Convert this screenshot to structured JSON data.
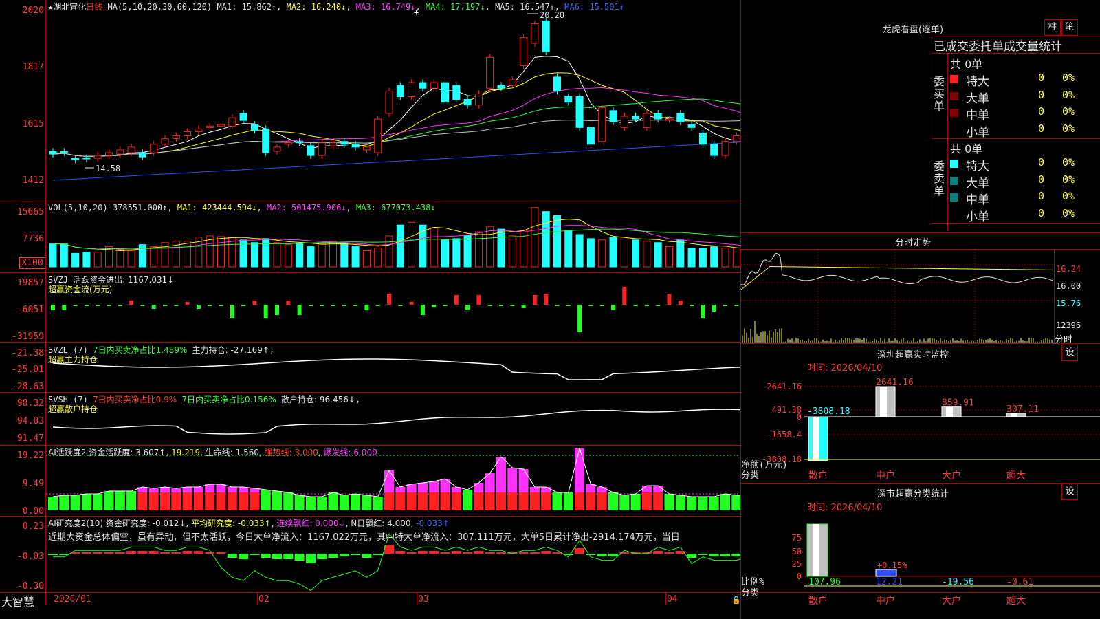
{
  "stock": {
    "star": "★",
    "name": "湖北宜化",
    "period": "日线"
  },
  "main_hdr": {
    "ma_params": "MA(5,10,20,30,60,120)",
    "ma1": "MA1: 15.862↑",
    "ma2": "MA2: 16.240↓",
    "ma3": "MA3: 16.749↓",
    "ma4": "MA4: 17.197↓",
    "ma5": "MA5: 16.547↑",
    "ma6": "MA6: 15.501↑"
  },
  "price_axis": [
    "2020",
    "1817",
    "1615",
    "1412"
  ],
  "price_note_high": "20.20",
  "price_note_low": "14.58",
  "vol_hdr": {
    "params": "VOL(5,10,20)",
    "val": "378551.000↑",
    "ma1": "MA1: 423444.594↓",
    "ma2": "MA2: 501475.906↓",
    "ma3": "MA3: 677073.438↓"
  },
  "vol_axis": [
    "15665",
    "7736",
    "X100"
  ],
  "svzj_hdr": {
    "name": "SVZJ",
    "text": "活跃资金进出: 1167.031↓",
    "sub": "超赢资金流(万元)"
  },
  "svzj_axis": [
    "19857",
    "-6051",
    "-31959"
  ],
  "svzl_hdr": {
    "name": "SVZL (7)",
    "t1": "7日内买卖净占比1.489%",
    "t2": "主力持仓: -27.169↑",
    "t3": ",",
    "sub": "超赢主力持仓"
  },
  "svzl_axis": [
    "-21.38",
    "-25.01",
    "-28.63"
  ],
  "svsh_hdr": {
    "name": "SVSH (7)",
    "t1": "7日内买卖净占比0.9%",
    "t2": "7日内买卖净占比0.156%",
    "t3": "散户持仓: 96.456↓",
    "t4": ",",
    "sub": "超赢散户持仓"
  },
  "svsh_axis": [
    "98.32",
    "94.83",
    "91.47"
  ],
  "ai1_hdr": {
    "name": "AI活跃度2",
    "t1": "资金活跃度: 3.607↑",
    "t2": "19.219",
    "t3": "生命线: 1.560",
    "t4": "强势线: 3.000",
    "t5": "爆发线: 6.000"
  },
  "ai1_axis": [
    "19.22",
    "9.49",
    "0.00"
  ],
  "ai2_hdr": {
    "name": "AI研究度2(10)",
    "t1": "资金研究度: -0.012↓",
    "t2": "平均研究度: -0.033↑",
    "t3": "连续飘红: 0.000↓",
    "t4": "N日飘红: 4.000",
    "t5": "-0.033↑"
  },
  "ai2_comment": "近期大资金总体偏空，虽有异动，但不太活跃，今日大单净流入：1167.022万元，其中特大单净流入：307.111万元，大单5日累计净出-2914.174万元，当日",
  "ai2_axis": [
    "0.23",
    "-0.03",
    "-0.30"
  ],
  "bottom": {
    "brand": "大智慧",
    "d1": "2026/01",
    "d2": "02",
    "d3": "03",
    "d4": "04"
  },
  "right": {
    "lhb_title": "龙虎看盘(逐单)",
    "btn_zhu": "柱",
    "btn_bi": "笔",
    "stat_title": "已成交委托单成交量统计",
    "buy_label": "委买单",
    "buy_total": "共 0单",
    "sell_label": "委卖单",
    "sell_total": "共 0单",
    "rows": [
      {
        "label": "特大",
        "count": "0",
        "pct": "0%"
      },
      {
        "label": "大单",
        "count": "0",
        "pct": "0%"
      },
      {
        "label": "中单",
        "count": "0",
        "pct": "0%"
      },
      {
        "label": "小单",
        "count": "0",
        "pct": "0%"
      }
    ],
    "fs_title": "分时走势",
    "fs_axis": [
      "16.24",
      "16.00",
      "15.76",
      "12396",
      "分时"
    ],
    "mon_title": "深圳超赢实时监控",
    "mon_time": "时间: 2026/04/10",
    "mon_axis": [
      "2641.16",
      "491.38",
      "0",
      "-1658.4",
      "-3808.18"
    ],
    "mon_vals": [
      "-3808.18",
      "2641.16",
      "859.91",
      "307.11"
    ],
    "mon_net": "净额(万元)",
    "mon_cat": "分类",
    "cats": [
      "散户",
      "中户",
      "大户",
      "超大"
    ],
    "cls_title": "深市超赢分类统计",
    "cls_time": "时间: 2026/04/10",
    "cls_axis": [
      "75",
      "50",
      "25",
      "0"
    ],
    "cls_vals": [
      "107.96",
      "12.21",
      "-19.56",
      "-0.61"
    ],
    "cls_note": "+0.15%",
    "cls_ratio": "比例%",
    "cls_cat": "分类",
    "btn_set": "设"
  },
  "colors": {
    "up": "#ff2020",
    "down": "#20ffff",
    "bg": "#000000",
    "grid": "#b00000",
    "ma1": "#ffffff",
    "ma2": "#ffff00",
    "ma3": "#ff30ff",
    "ma4": "#30ff30",
    "ma5": "#c0c0c0",
    "ma6": "#3050ff"
  },
  "chart_data": {
    "type": "candlestick",
    "candles": [
      {
        "o": 15.15,
        "c": 15.05
      },
      {
        "o": 15.15,
        "c": 15.1
      },
      {
        "o": 14.9,
        "c": 14.85
      },
      {
        "o": 14.92,
        "c": 14.88
      },
      {
        "o": 14.9,
        "c": 15.0
      },
      {
        "o": 15.0,
        "c": 15.1
      },
      {
        "o": 15.05,
        "c": 15.2
      },
      {
        "o": 15.1,
        "c": 15.3
      },
      {
        "o": 15.1,
        "c": 14.95
      },
      {
        "o": 15.1,
        "c": 15.4
      },
      {
        "o": 15.4,
        "c": 15.6
      },
      {
        "o": 15.6,
        "c": 15.7
      },
      {
        "o": 15.7,
        "c": 15.85
      },
      {
        "o": 15.85,
        "c": 15.95
      },
      {
        "o": 16.0,
        "c": 16.05
      },
      {
        "o": 16.05,
        "c": 16.1
      },
      {
        "o": 16.05,
        "c": 16.35
      },
      {
        "o": 16.5,
        "c": 16.25
      },
      {
        "o": 16.1,
        "c": 15.9
      },
      {
        "o": 15.95,
        "c": 15.1
      },
      {
        "o": 15.15,
        "c": 15.3
      },
      {
        "o": 15.4,
        "c": 15.45
      },
      {
        "o": 15.5,
        "c": 15.45
      },
      {
        "o": 15.35,
        "c": 15.0
      },
      {
        "o": 15.0,
        "c": 15.45
      },
      {
        "o": 15.35,
        "c": 15.45
      },
      {
        "o": 15.5,
        "c": 15.4
      },
      {
        "o": 15.4,
        "c": 15.3
      },
      {
        "o": 15.2,
        "c": 15.3
      },
      {
        "o": 15.1,
        "c": 16.3
      },
      {
        "o": 16.5,
        "c": 17.3
      },
      {
        "o": 17.5,
        "c": 17.1
      },
      {
        "o": 17.1,
        "c": 17.6
      },
      {
        "o": 17.6,
        "c": 17.4
      },
      {
        "o": 17.4,
        "c": 17.6
      },
      {
        "o": 17.6,
        "c": 16.9
      },
      {
        "o": 17.5,
        "c": 17.0
      },
      {
        "o": 17.0,
        "c": 16.8
      },
      {
        "o": 16.8,
        "c": 17.2
      },
      {
        "o": 17.4,
        "c": 18.5
      },
      {
        "o": 17.5,
        "c": 17.4
      },
      {
        "o": 17.5,
        "c": 17.7
      },
      {
        "o": 18.2,
        "c": 19.2
      },
      {
        "o": 19.0,
        "c": 19.7
      },
      {
        "o": 19.8,
        "c": 18.7
      },
      {
        "o": 17.8,
        "c": 17.3
      },
      {
        "o": 17.1,
        "c": 16.9
      },
      {
        "o": 17.1,
        "c": 16.0
      },
      {
        "o": 16.0,
        "c": 15.4
      },
      {
        "o": 15.5,
        "c": 16.7
      },
      {
        "o": 16.6,
        "c": 16.2
      },
      {
        "o": 16.0,
        "c": 16.4
      },
      {
        "o": 16.4,
        "c": 16.3
      },
      {
        "o": 16.0,
        "c": 16.5
      },
      {
        "o": 16.5,
        "c": 16.3
      },
      {
        "o": 16.3,
        "c": 16.3
      },
      {
        "o": 16.5,
        "c": 16.2
      },
      {
        "o": 16.1,
        "c": 16.0
      },
      {
        "o": 15.8,
        "c": 15.4
      },
      {
        "o": 15.4,
        "c": 15.0
      },
      {
        "o": 15.0,
        "c": 15.5
      },
      {
        "o": 15.5,
        "c": 15.7
      },
      {
        "o": 15.65,
        "c": 15.65
      },
      {
        "o": 15.65,
        "c": 15.75
      }
    ],
    "price_range": [
      14.12,
      20.2
    ],
    "volume": [
      34,
      34,
      20,
      22,
      22,
      30,
      26,
      24,
      33,
      30,
      36,
      38,
      38,
      44,
      46,
      45,
      44,
      40,
      36,
      42,
      36,
      33,
      35,
      30,
      34,
      38,
      34,
      30,
      24,
      28,
      46,
      62,
      66,
      62,
      58,
      40,
      42,
      47,
      52,
      60,
      56,
      46,
      54,
      88,
      82,
      76,
      54,
      48,
      42,
      40,
      44,
      44,
      40,
      38,
      36,
      30,
      40,
      28,
      28,
      30,
      28,
      28,
      24,
      24
    ]
  }
}
